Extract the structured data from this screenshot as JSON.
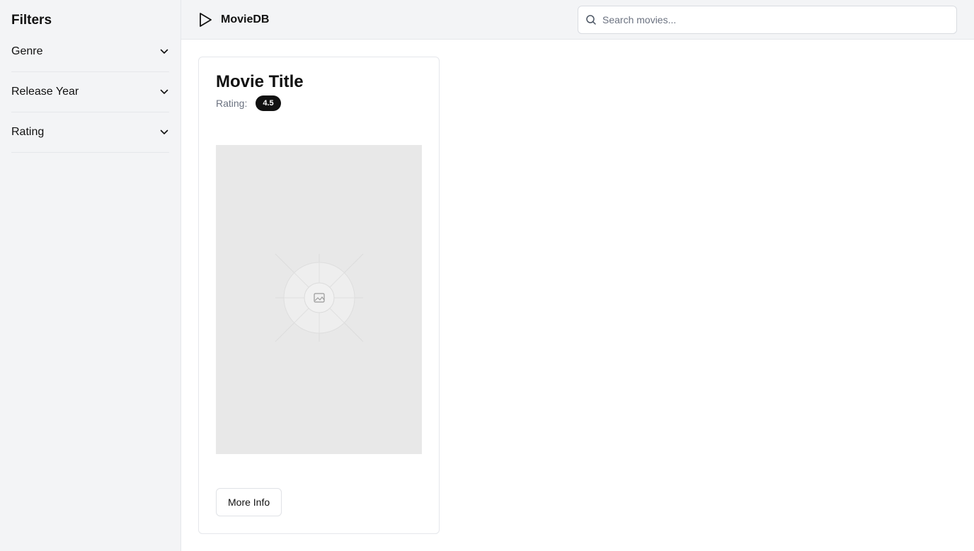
{
  "sidebar": {
    "title": "Filters",
    "items": [
      {
        "label": "Genre",
        "icon": "chevron-down-icon"
      },
      {
        "label": "Release Year",
        "icon": "chevron-down-icon"
      },
      {
        "label": "Rating",
        "icon": "chevron-down-icon"
      }
    ]
  },
  "header": {
    "brand_icon": "play-icon",
    "brand_name": "MovieDB",
    "search": {
      "placeholder": "Search movies...",
      "value": "",
      "icon": "search-icon"
    }
  },
  "card": {
    "title": "Movie Title",
    "rating_label": "Rating:",
    "rating_value": "4.5",
    "poster_icon": "image-placeholder-icon",
    "button_label": "More Info"
  },
  "colors": {
    "sidebar_bg": "#f3f4f6",
    "badge_bg": "#111111",
    "poster_bg": "#e8e8e8",
    "border": "#e5e7eb"
  }
}
